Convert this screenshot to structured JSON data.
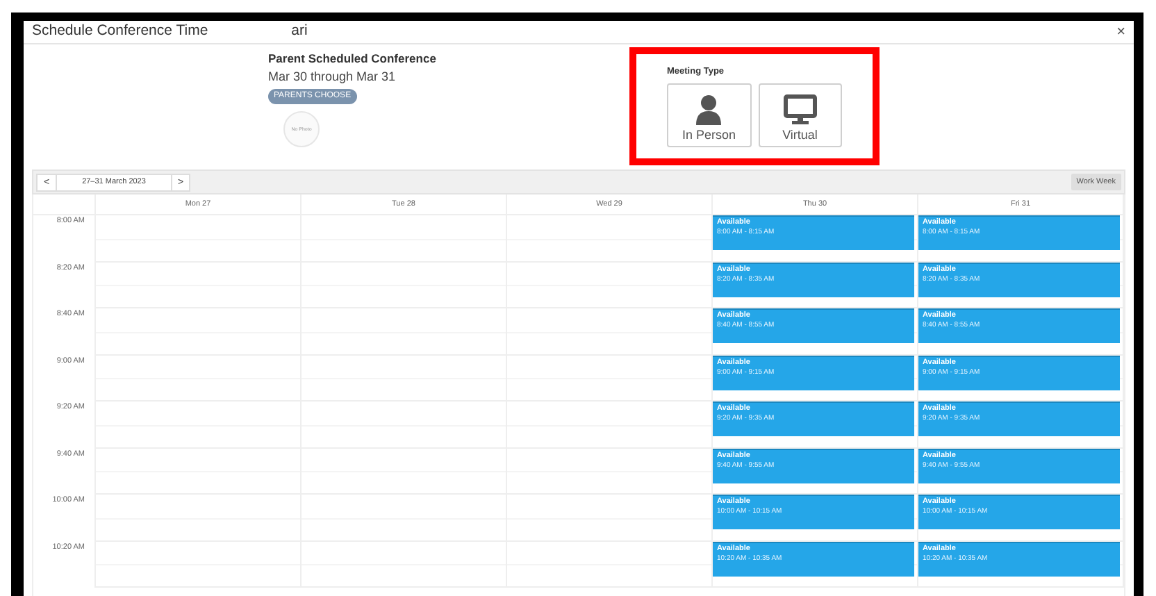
{
  "dialog": {
    "title": "Schedule Conference Time",
    "title_fragment": "ari",
    "close": "×"
  },
  "conference": {
    "heading": "Parent Scheduled Conference",
    "dates": "Mar 30 through Mar 31",
    "badge": "PARENTS CHOOSE",
    "photo_placeholder": "No Photo"
  },
  "meeting_type": {
    "label": "Meeting Type",
    "options": [
      {
        "kind": "person",
        "label": "In Person"
      },
      {
        "kind": "monitor",
        "label": "Virtual"
      }
    ]
  },
  "toolbar": {
    "prev": "<",
    "range": "27–31 March 2023",
    "next": ">",
    "view": "Work Week"
  },
  "calendar": {
    "times": [
      "8:00 AM",
      "8:20 AM",
      "8:40 AM",
      "9:00 AM",
      "9:20 AM",
      "9:40 AM",
      "10:00 AM",
      "10:20 AM"
    ],
    "days": [
      {
        "label": "Mon 27"
      },
      {
        "label": "Tue 28"
      },
      {
        "label": "Wed 29"
      },
      {
        "label": "Thu 30",
        "events": [
          {
            "title": "Available",
            "time": "8:00 AM - 8:15 AM"
          },
          {
            "title": "Available",
            "time": "8:20 AM - 8:35 AM"
          },
          {
            "title": "Available",
            "time": "8:40 AM - 8:55 AM"
          },
          {
            "title": "Available",
            "time": "9:00 AM - 9:15 AM"
          },
          {
            "title": "Available",
            "time": "9:20 AM - 9:35 AM"
          },
          {
            "title": "Available",
            "time": "9:40 AM - 9:55 AM"
          },
          {
            "title": "Available",
            "time": "10:00 AM - 10:15 AM"
          },
          {
            "title": "Available",
            "time": "10:20 AM - 10:35 AM"
          }
        ]
      },
      {
        "label": "Fri 31",
        "events": [
          {
            "title": "Available",
            "time": "8:00 AM - 8:15 AM"
          },
          {
            "title": "Available",
            "time": "8:20 AM - 8:35 AM"
          },
          {
            "title": "Available",
            "time": "8:40 AM - 8:55 AM"
          },
          {
            "title": "Available",
            "time": "9:00 AM - 9:15 AM"
          },
          {
            "title": "Available",
            "time": "9:20 AM - 9:35 AM"
          },
          {
            "title": "Available",
            "time": "9:40 AM - 9:55 AM"
          },
          {
            "title": "Available",
            "time": "10:00 AM - 10:15 AM"
          },
          {
            "title": "Available",
            "time": "10:20 AM - 10:35 AM"
          }
        ]
      }
    ]
  }
}
